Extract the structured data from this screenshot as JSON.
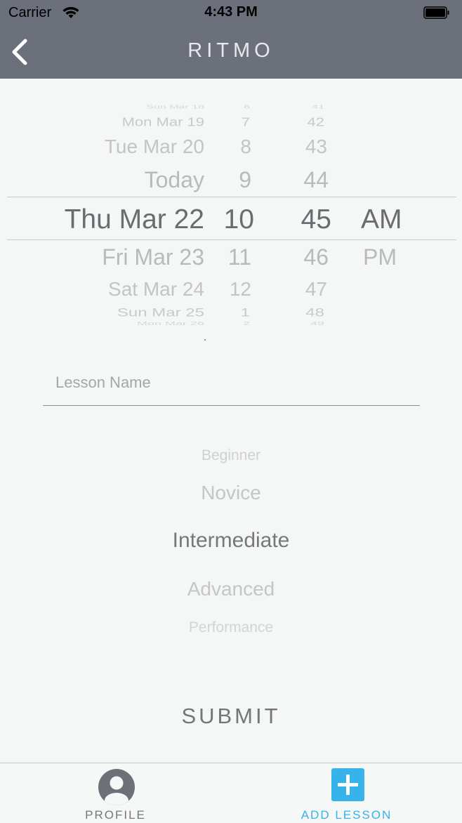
{
  "status_bar": {
    "carrier": "Carrier",
    "time": "4:43 PM",
    "wifi_icon": "wifi-icon",
    "battery_icon": "battery-icon"
  },
  "header": {
    "title": "RITMO",
    "back_icon": "chevron-left-icon"
  },
  "datetime_picker": {
    "dates": [
      "Sun Mar 18",
      "Mon Mar 19",
      "Tue Mar 20",
      "Today",
      "Thu Mar 22",
      "Fri Mar 23",
      "Sat Mar 24",
      "Sun Mar 25",
      "Mon Mar 26"
    ],
    "hours": [
      "6",
      "7",
      "8",
      "9",
      "10",
      "11",
      "12",
      "1",
      "2"
    ],
    "minutes": [
      "41",
      "42",
      "43",
      "44",
      "45",
      "46",
      "47",
      "48",
      "49"
    ],
    "periods": [
      "AM",
      "PM"
    ],
    "selected": {
      "date": "Thu Mar 22",
      "hour": "10",
      "minute": "45",
      "period": "AM"
    }
  },
  "lesson_name": {
    "placeholder": "Lesson Name",
    "value": ""
  },
  "level_picker": {
    "options": [
      "Beginner",
      "Novice",
      "Intermediate",
      "Advanced",
      "Performance"
    ],
    "selected": "Intermediate"
  },
  "submit": {
    "label": "SUBMIT"
  },
  "tab_bar": {
    "tabs": [
      {
        "label": "PROFILE",
        "icon": "profile-icon",
        "active": false
      },
      {
        "label": "ADD LESSON",
        "icon": "add-icon",
        "active": true
      }
    ]
  },
  "colors": {
    "header_bg": "#6c707b",
    "accent": "#36b3ea",
    "background": "#f5f6f6"
  }
}
